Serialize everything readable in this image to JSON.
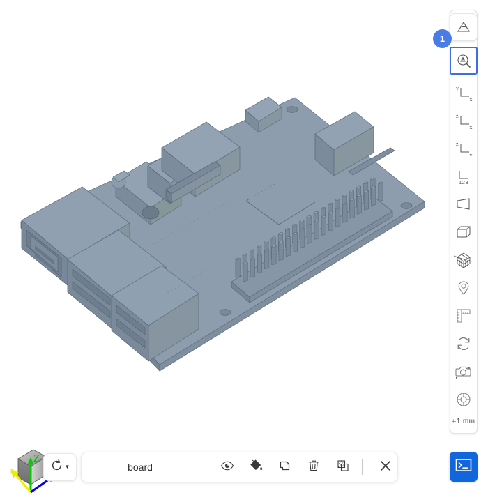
{
  "app": {
    "background_color": "#ffffff",
    "accent_color": "#3d6fe0",
    "badge_color": "#4a7ce8",
    "terminal_color": "#1266dd"
  },
  "viewport": {
    "name": "3d-viewport",
    "model_name": "Raspberry Pi board",
    "model_face_color": "#8b9bab",
    "model_top_color": "#95a4b3",
    "model_side_color": "#7c8c9c",
    "model_edge_color": "#5f6e7e"
  },
  "right_toolbar": {
    "badge": "1",
    "scale_label": "⌗1 mm",
    "items": [
      {
        "icon": "section-plane-icon",
        "label": "Section / clipping plane",
        "state": "raised"
      },
      {
        "icon": "zoom-section-icon",
        "label": "Zoom to section",
        "state": "active"
      },
      {
        "icon": "axis-yx-icon",
        "label": "Top view (Y-X)",
        "state": "normal"
      },
      {
        "icon": "axis-zx-icon",
        "label": "Front view (Z-X)",
        "state": "normal"
      },
      {
        "icon": "axis-zy-icon",
        "label": "Side view (Z-Y)",
        "state": "normal"
      },
      {
        "icon": "axis-numbers-icon",
        "label": "Coordinate numbers",
        "state": "normal"
      },
      {
        "icon": "perspective-icon",
        "label": "Perspective projection",
        "state": "normal"
      },
      {
        "icon": "box-icon",
        "label": "Bounding box",
        "state": "normal"
      },
      {
        "icon": "grid-cube-icon",
        "label": "Grid cube",
        "state": "normal"
      },
      {
        "icon": "pin-icon",
        "label": "Place marker",
        "state": "normal"
      },
      {
        "icon": "ruler-icon",
        "label": "Measure",
        "state": "normal"
      },
      {
        "icon": "refresh-icon",
        "label": "Refresh view",
        "state": "normal"
      },
      {
        "icon": "camera-icon",
        "label": "Screenshot",
        "state": "normal"
      },
      {
        "icon": "gasket-icon",
        "label": "Render settings",
        "state": "normal"
      }
    ]
  },
  "terminal_button": {
    "icon": "terminal-icon",
    "label": "Open console"
  },
  "nav_cube": {
    "name": "navigation-cube",
    "axes": [
      {
        "name": "z-axis",
        "label": "Z",
        "color": "#00d000"
      },
      {
        "name": "y-axis",
        "label": "Y",
        "color": "#f2f200"
      },
      {
        "name": "x-axis",
        "label": "",
        "color": "#0000f0"
      }
    ]
  },
  "reload_button": {
    "icon": "reload-icon",
    "caret": "▼",
    "label": "Reload model"
  },
  "bottom_bar": {
    "object_label": "board",
    "actions": [
      {
        "icon": "eye-icon",
        "label": "Toggle visibility"
      },
      {
        "icon": "paint-bucket-icon",
        "label": "Appearance"
      },
      {
        "icon": "copy-icon",
        "label": "Duplicate"
      },
      {
        "icon": "trash-icon",
        "label": "Delete"
      },
      {
        "icon": "transparency-icon",
        "label": "Transparency"
      },
      {
        "icon": "close-icon",
        "label": "Close"
      }
    ]
  }
}
